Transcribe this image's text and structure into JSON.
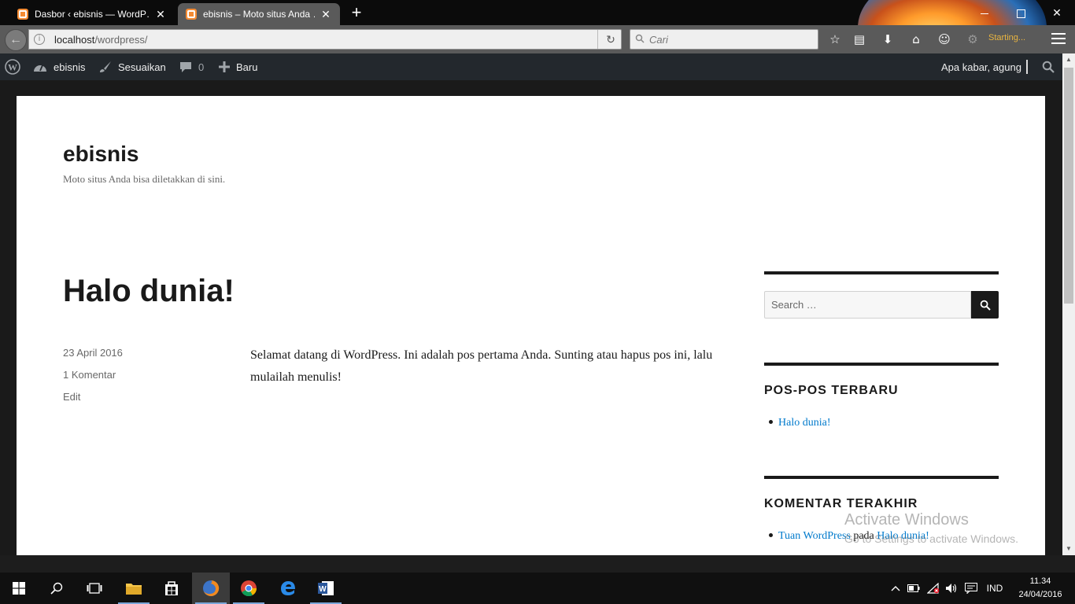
{
  "browser": {
    "tabs": [
      {
        "title": "Dasbor ‹ ebisnis — WordP…",
        "active": false
      },
      {
        "title": "ebisnis – Moto situs Anda …",
        "active": true
      }
    ],
    "url_host": "localhost",
    "url_path": "/wordpress/",
    "search_placeholder": "Cari",
    "status_text": "Starting..."
  },
  "adminbar": {
    "site_name": "ebisnis",
    "customize": "Sesuaikan",
    "comments_count": "0",
    "new": "Baru",
    "howdy": "Apa kabar, agung"
  },
  "site": {
    "title": "ebisnis",
    "description": "Moto situs Anda bisa diletakkan di sini."
  },
  "post": {
    "title": "Halo dunia!",
    "date": "23 April 2016",
    "comments": "1 Komentar",
    "edit": "Edit",
    "content": "Selamat datang di WordPress. Ini adalah pos pertama Anda. Sunting atau hapus pos ini, lalu mulailah menulis!"
  },
  "sidebar": {
    "search_placeholder": "Search …",
    "recent_posts_title": "POS-POS TERBARU",
    "recent_posts": [
      "Halo dunia!"
    ],
    "recent_comments_title": "KOMENTAR TERAKHIR",
    "recent_comment": {
      "author": "Tuan WordPress",
      "connector": "pada",
      "post": "Halo dunia!"
    }
  },
  "watermark": {
    "line1": "Activate Windows",
    "line2": "Go to Settings to activate Windows."
  },
  "taskbar": {
    "language": "IND",
    "time": "11.34",
    "date": "24/04/2016"
  },
  "colors": {
    "wp_link": "#007acc",
    "adminbar_bg": "#23282d",
    "browser_chrome": "#5a5a5a"
  }
}
